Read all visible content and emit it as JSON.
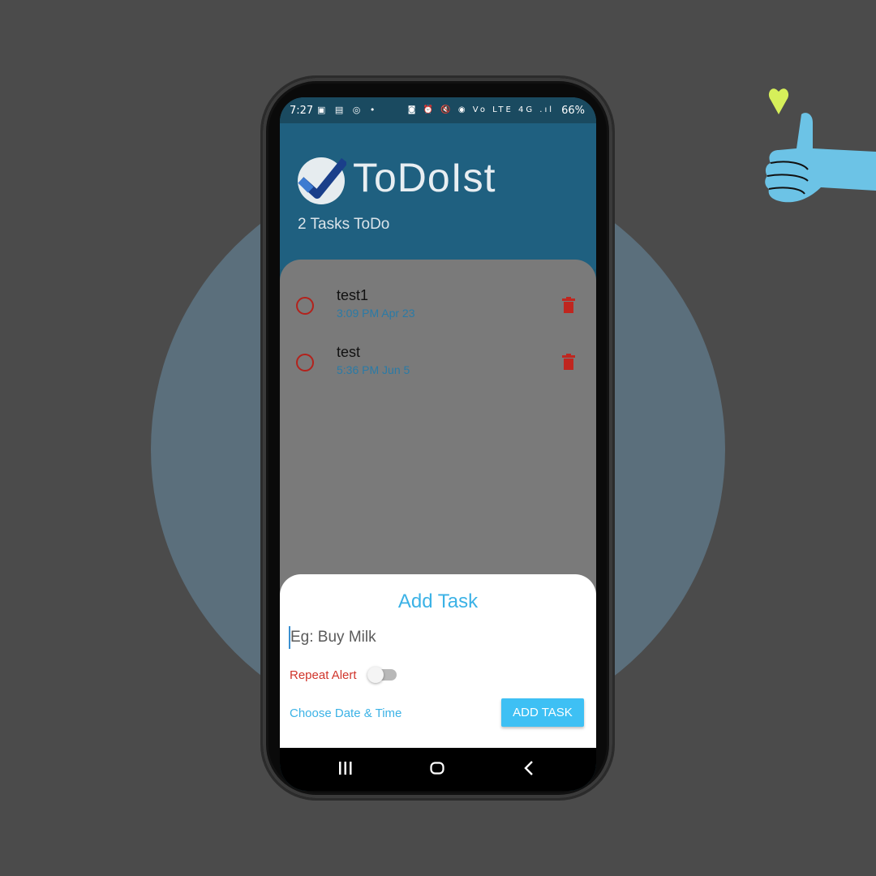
{
  "statusbar": {
    "time": "7:27",
    "left_icons": "▣ ▤ ◎ •",
    "right_icons": "◙ ⏰ 🔇 ◉ Vo LTE 4G .ıl",
    "battery": "66%"
  },
  "app": {
    "name": "ToDoIst",
    "task_count": "2 Tasks ToDo",
    "logo_icon": "check-circle-icon"
  },
  "tasks": [
    {
      "title": "test1",
      "datetime": "3:09 PM Apr 23"
    },
    {
      "title": "test",
      "datetime": "5:36 PM Jun 5"
    }
  ],
  "sheet": {
    "title": "Add Task",
    "input_placeholder": "Eg: Buy Milk",
    "input_value": "",
    "repeat_label": "Repeat Alert",
    "repeat_enabled": false,
    "choose_date_label": "Choose Date & Time",
    "add_button_label": "ADD TASK"
  },
  "colors": {
    "background": "#4b4b4b",
    "circle": "#5b6f7c",
    "header": "#1f6080",
    "accent": "#3ec0f4",
    "danger": "#d0352b"
  },
  "decoration": {
    "icons": [
      "heart-icon",
      "thumbs-up-icon"
    ]
  }
}
